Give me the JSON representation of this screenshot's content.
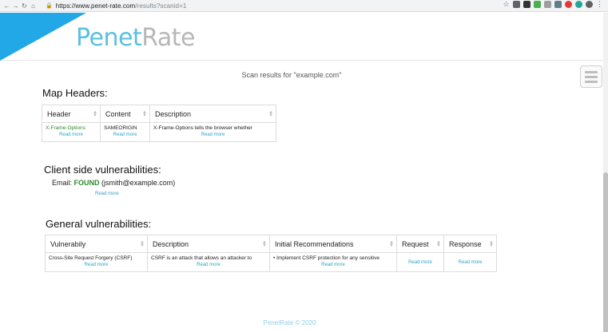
{
  "browser": {
    "url_host": "https://www.penet-rate.com",
    "url_path": "/results?scanid=1"
  },
  "brand": {
    "logo_part1": "Penet",
    "logo_part2": "Rate",
    "accent": "#22a8e6"
  },
  "scan_title": "Scan results for \"example.com\"",
  "map_headers": {
    "title": "Map Headers:",
    "columns": [
      "Header",
      "Content",
      "Description"
    ],
    "rows": [
      {
        "header": "X-Frame-Options",
        "content": "SAMEORIGIN",
        "description": "X-Frame-Options tells the browser whether",
        "more": "Read more"
      }
    ]
  },
  "client_side": {
    "title": "Client side vulnerabilities:",
    "email_label": "Email:",
    "status": "FOUND",
    "email": "(jsmith@example.com)",
    "more": "Read more"
  },
  "general": {
    "title": "General vulnerabilities:",
    "columns": [
      "Vulnerabily",
      "Description",
      "Initial Recommendations",
      "Request",
      "Response"
    ],
    "rows": [
      {
        "vulnerability": "Cross-Site Request Forgery (CSRF)",
        "description": "CSRF is an attack that allows an attacker to",
        "recommendation": "• Implement CSRF protection for any sensitive",
        "request": "Read more",
        "response": "Read more",
        "more": "Read more"
      }
    ]
  },
  "footer": "PenetRate © 2020"
}
